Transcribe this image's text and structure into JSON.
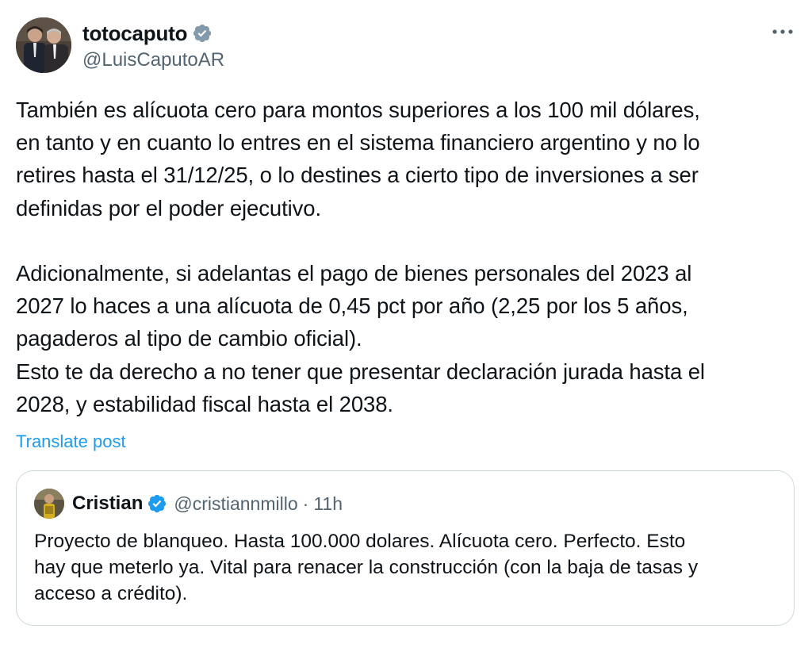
{
  "tweet": {
    "author": {
      "display_name": "totocaputo",
      "handle": "@LuisCaputoAR",
      "verified_badge_color": "#829aab"
    },
    "body": "También es alícuota cero para montos superiores a los 100 mil dólares,\nen tanto y en cuanto lo entres en el sistema financiero argentino y no lo\nretires hasta el 31/12/25, o lo destines a cierto tipo de inversiones a ser\ndefinidas por el poder ejecutivo.\n\nAdicionalmente, si adelantas el pago de bienes personales del 2023 al\n2027 lo haces a una alícuota de 0,45 pct por año (2,25 por los 5 años,\npagaderos al tipo de cambio oficial).\nEsto te da derecho a no tener que presentar declaración jurada hasta el\n2028, y estabilidad fiscal hasta el 2038.",
    "translate_label": "Translate post",
    "more_icon": "ellipsis-icon",
    "quoted": {
      "display_name": "Cristian",
      "handle": "@cristiannmillo",
      "separator": "·",
      "time": "11h",
      "verified_badge_color": "#1d9bf0",
      "text": "Proyecto de blanqueo. Hasta 100.000 dolares. Alícuota cero. Perfecto. Esto\nhay que meterlo ya. Vital para renacer la construcción (con la baja de tasas y\nacceso a crédito)."
    }
  },
  "colors": {
    "link": "#1d9bf0",
    "secondary_text": "#536471",
    "primary_text": "#0f1419",
    "border": "#cfd9de"
  }
}
